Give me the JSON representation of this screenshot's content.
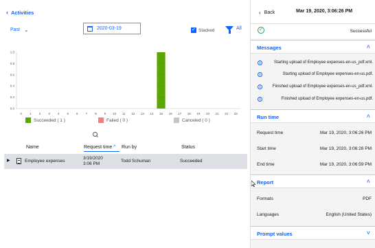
{
  "left": {
    "back_label": "Activities",
    "period_label": "Past",
    "date_value": "2020-03-19",
    "stacked_label": "Stacked",
    "filter_label": "All"
  },
  "chart_data": {
    "type": "bar",
    "categories": [
      "0",
      "1",
      "2",
      "3",
      "4",
      "5",
      "6",
      "7",
      "8",
      "9",
      "10",
      "11",
      "12",
      "13",
      "14",
      "15",
      "16",
      "17",
      "18",
      "19",
      "20",
      "21",
      "22",
      "23"
    ],
    "series": [
      {
        "name": "Succeeded ( 1 )",
        "color": "#5aa700",
        "values": [
          0,
          0,
          0,
          0,
          0,
          0,
          0,
          0,
          0,
          0,
          0,
          0,
          0,
          0,
          0,
          1,
          0,
          0,
          0,
          0,
          0,
          0,
          0,
          0
        ]
      },
      {
        "name": "Failed ( 0 )",
        "color": "#f08080",
        "values": [
          0,
          0,
          0,
          0,
          0,
          0,
          0,
          0,
          0,
          0,
          0,
          0,
          0,
          0,
          0,
          0,
          0,
          0,
          0,
          0,
          0,
          0,
          0,
          0
        ]
      },
      {
        "name": "Canceled ( 0 )",
        "color": "#c6c6c6",
        "values": [
          0,
          0,
          0,
          0,
          0,
          0,
          0,
          0,
          0,
          0,
          0,
          0,
          0,
          0,
          0,
          0,
          0,
          0,
          0,
          0,
          0,
          0,
          0,
          0
        ]
      }
    ],
    "y_ticks": [
      "0.0",
      "0.2",
      "0.4",
      "0.6",
      "0.8",
      "1.0"
    ],
    "ylim": [
      0,
      1.0
    ],
    "grid": false,
    "legend_position": "bottom"
  },
  "legend": {
    "succeeded": "Succeeded ( 1 )",
    "failed": "Failed ( 0 )",
    "canceled": "Canceled ( 0 )"
  },
  "table": {
    "headers": {
      "name": "Name",
      "request_time": "Request time",
      "run_by": "Run by",
      "status": "Status"
    },
    "rows": [
      {
        "name": "Employee expenses",
        "req_date": "3/19/2020",
        "req_time": "3:06 PM",
        "run_by": "Todd Schuman",
        "status": "Succeeded"
      }
    ]
  },
  "right": {
    "back_label": "Back",
    "timestamp": "Mar 19, 2020, 3:06:26 PM",
    "status": "Successful",
    "messages_title": "Messages",
    "messages": [
      "Starting upload of Employee expenses-en-us_pdf.xml.",
      "Starting upload of Employee expenses-en-us.pdf.",
      "Finished upload of Employee expenses-en-us_pdf.xml.",
      "Finished upload of Employee expenses-en-us.pdf."
    ],
    "runtime_title": "Run time",
    "runtime": {
      "request_label": "Request time",
      "request_value": "Mar 19, 2020, 3:06:26 PM",
      "start_label": "Start time",
      "start_value": "Mar 19, 2020, 3:06:26 PM",
      "end_label": "End time",
      "end_value": "Mar 19, 2020, 3:06:59 PM"
    },
    "report_title": "Report",
    "report": {
      "formats_label": "Formats",
      "formats_value": "PDF",
      "languages_label": "Languages",
      "languages_value": "English (United States)"
    },
    "prompt_title": "Prompt values"
  },
  "colors": {
    "accent": "#0f62fe",
    "success": "#24a148",
    "bar_success": "#5aa700",
    "selected_row": "#dde1e6"
  }
}
